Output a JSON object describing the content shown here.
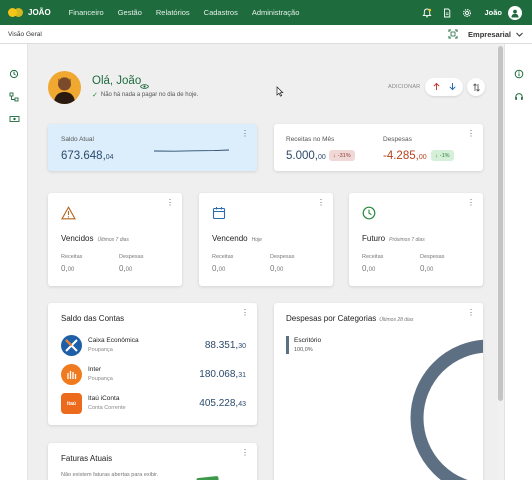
{
  "topbar": {
    "brand": "JOÃO",
    "nav": [
      "Financeiro",
      "Gestão",
      "Relatórios",
      "Cadastros",
      "Administração"
    ],
    "user": "João"
  },
  "subbar": {
    "breadcrumb": "Visão Geral",
    "mode": "Empresarial"
  },
  "greeting": {
    "title": "Olá, João",
    "subtitle": "Não há nada a pagar no dia de hoje.",
    "add_label": "ADICIONAR"
  },
  "balance": {
    "label": "Saldo Atual",
    "int": "673.648,",
    "dec": "04"
  },
  "month": {
    "income_label": "Receitas no Mês",
    "income_int": "5.000,",
    "income_dec": "00",
    "income_change": "-31%",
    "expense_label": "Despesas",
    "expense_int": "-4.285,",
    "expense_dec": "00",
    "expense_change": "-1%"
  },
  "status_cards": [
    {
      "title": "Vencidos",
      "period": "Últimos 7 dias",
      "income_label": "Receitas",
      "expense_label": "Despesas",
      "income_int": "0,",
      "income_dec": "00",
      "expense_int": "0,",
      "expense_dec": "00",
      "color": "#b5651d"
    },
    {
      "title": "Vencendo",
      "period": "Hoje",
      "income_label": "Receitas",
      "expense_label": "Despesas",
      "income_int": "0,",
      "income_dec": "00",
      "expense_int": "0,",
      "expense_dec": "00",
      "color": "#2b6cb0"
    },
    {
      "title": "Futuro",
      "period": "Próximos 7 dias",
      "income_label": "Receitas",
      "expense_label": "Despesas",
      "income_int": "0,",
      "income_dec": "00",
      "expense_int": "0,",
      "expense_dec": "00",
      "color": "#2a8a3e"
    }
  ],
  "accounts": {
    "title": "Saldo das Contas",
    "items": [
      {
        "name": "Caixa Econômica",
        "type": "Poupança",
        "int": "88.351,",
        "dec": "30",
        "color": "#1f5fa8",
        "icon": "caixa-logo"
      },
      {
        "name": "Inter",
        "type": "Poupança",
        "int": "180.068,",
        "dec": "31",
        "color": "#f07b1e",
        "icon": "inter-logo"
      },
      {
        "name": "Itaú iConta",
        "type": "Conta Corrente",
        "int": "405.228,",
        "dec": "43",
        "color": "#ec6a1c",
        "icon": "itau-logo",
        "logo_text": "itaú"
      }
    ]
  },
  "expenses": {
    "title": "Despesas por Categorias",
    "period": "Últimos 28 dias",
    "categories": [
      {
        "name": "Escritório",
        "pct": "100,0%"
      }
    ]
  },
  "invoices": {
    "title": "Faturas Atuais",
    "note": "Não existem faturas abertas para exibir."
  },
  "colors": {
    "brand_green": "#1e6b3e",
    "accent_yellow": "#f5c518",
    "value_blue": "#2b4a6b",
    "expense_red": "#b5431f"
  }
}
